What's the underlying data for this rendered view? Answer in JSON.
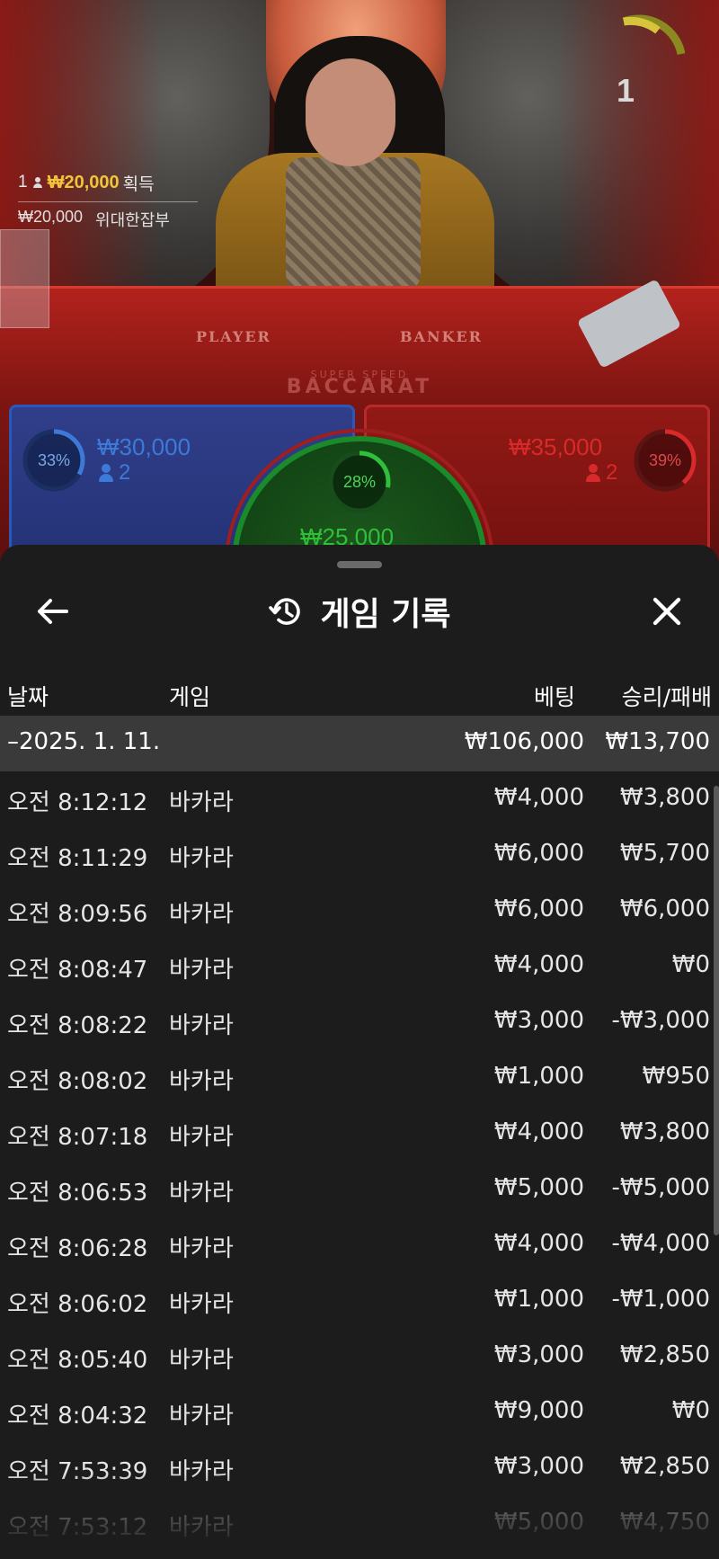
{
  "live": {
    "timer_value": "1",
    "win_count": "1",
    "win_amount": "₩20,000",
    "win_label": "획득",
    "jackpot_amount": "₩20,000",
    "jackpot_label": "위대한잡부",
    "table_player_word": "PLAYER",
    "table_banker_word": "BANKER",
    "table_logo_top": "SUPER SPEED",
    "table_logo_main": "BACCARAT",
    "player": {
      "percent": "33%",
      "amount": "₩30,000",
      "count": "2",
      "color": "#3d7ad8"
    },
    "banker": {
      "percent": "39%",
      "amount": "₩35,000",
      "count": "2",
      "color": "#d82a2a"
    },
    "tie": {
      "percent": "28%",
      "amount": "₩25,000",
      "color": "#2fbf3a"
    },
    "player_share": 0.33,
    "banker_share": 0.39,
    "tie_share": 0.28
  },
  "sheet": {
    "title": "게임 기록",
    "title_icon": "history-icon",
    "back_icon": "arrow-left-icon",
    "close_icon": "close-icon",
    "columns": {
      "date": "날짜",
      "game": "게임",
      "bet": "베팅",
      "result": "승리/패배"
    },
    "date_group": {
      "label": "–2025. 1. 11.",
      "bet": "₩106,000",
      "result": "₩13,700"
    },
    "rows": [
      {
        "time": "오전 8:12:12",
        "game": "바카라",
        "bet": "₩4,000",
        "result": "₩3,800"
      },
      {
        "time": "오전 8:11:29",
        "game": "바카라",
        "bet": "₩6,000",
        "result": "₩5,700"
      },
      {
        "time": "오전 8:09:56",
        "game": "바카라",
        "bet": "₩6,000",
        "result": "₩6,000"
      },
      {
        "time": "오전 8:08:47",
        "game": "바카라",
        "bet": "₩4,000",
        "result": "₩0"
      },
      {
        "time": "오전 8:08:22",
        "game": "바카라",
        "bet": "₩3,000",
        "result": "-₩3,000"
      },
      {
        "time": "오전 8:08:02",
        "game": "바카라",
        "bet": "₩1,000",
        "result": "₩950"
      },
      {
        "time": "오전 8:07:18",
        "game": "바카라",
        "bet": "₩4,000",
        "result": "₩3,800"
      },
      {
        "time": "오전 8:06:53",
        "game": "바카라",
        "bet": "₩5,000",
        "result": "-₩5,000"
      },
      {
        "time": "오전 8:06:28",
        "game": "바카라",
        "bet": "₩4,000",
        "result": "-₩4,000"
      },
      {
        "time": "오전 8:06:02",
        "game": "바카라",
        "bet": "₩1,000",
        "result": "-₩1,000"
      },
      {
        "time": "오전 8:05:40",
        "game": "바카라",
        "bet": "₩3,000",
        "result": "₩2,850"
      },
      {
        "time": "오전 8:04:32",
        "game": "바카라",
        "bet": "₩9,000",
        "result": "₩0"
      },
      {
        "time": "오전 7:53:39",
        "game": "바카라",
        "bet": "₩3,000",
        "result": "₩2,850"
      },
      {
        "time": "오전 7:53:12",
        "game": "바카라",
        "bet": "₩5,000",
        "result": "₩4,750"
      }
    ]
  }
}
